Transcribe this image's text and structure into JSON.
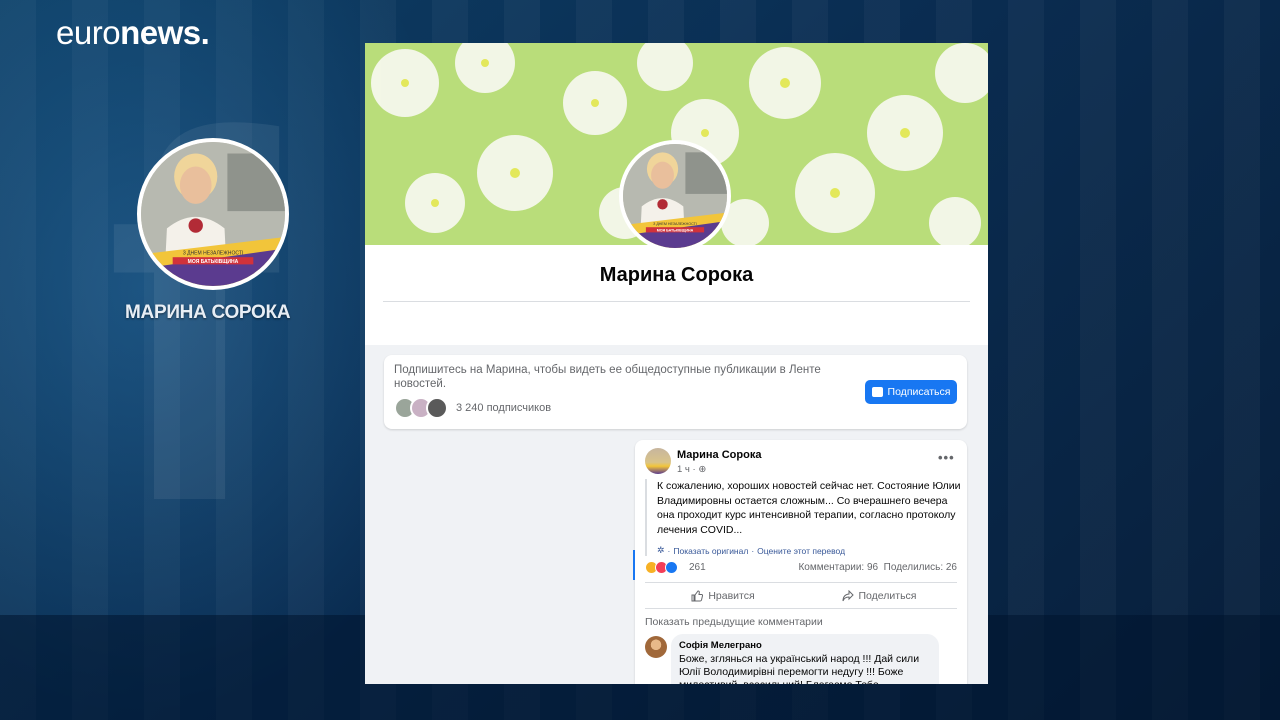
{
  "broadcast": {
    "logo_part1": "euro",
    "logo_part2": "news",
    "logo_dot": ".",
    "overlay_name": "МАРИНА СОРОКА",
    "avatar_caption_line1": "З ДНЕМ НЕЗАЛЕЖНОСТІ",
    "avatar_caption_line2": "МОЯ БАТЬКІВЩИНА",
    "colors": {
      "background": "#0a2d52",
      "facebook_blue": "#1877f2"
    }
  },
  "profile": {
    "name": "Марина Сорока",
    "avatar_caption_line1": "З ДНЕМ НЕЗАЛЕЖНОСТІ",
    "avatar_caption_line2": "МОЯ БАТЬКІВЩИНА"
  },
  "follow_card": {
    "text": "Подпишитесь на Марина, чтобы видеть ее общедоступные публикации в Ленте новостей.",
    "followers": "3 240 подписчиков",
    "button_label": "Подписаться",
    "button_icon": "follow-icon"
  },
  "post": {
    "author": "Марина Сорока",
    "time": "1 ч",
    "time_separator": "·",
    "visibility_icon": "globe-icon",
    "more_label": "•••",
    "text": "К сожалению, хороших новостей сейчас нет. Состояние Юлии Владимировны остается сложным... Со вчерашнего вечера она проходит курс интенсивной терапии, согласно протоколу лечения COVID...",
    "translate_show": "Показать оригинал",
    "translate_separator": "·",
    "translate_rate": "Оцените этот перевод",
    "reactions_count": "261",
    "comments": "Комментарии: 96",
    "shares": "Поделились: 26",
    "like_label": "Нравится",
    "share_label": "Поделиться",
    "previous_comments": "Показать предыдущие комментарии"
  },
  "comment": {
    "author": "Софія Мелеграно",
    "text": "Боже, зглянься на український народ !!! Дай сили Юлії Володимирівні перемогти недугу !!! Боже милостивий, всесильний! Благаємо Тебе допоможи..."
  }
}
